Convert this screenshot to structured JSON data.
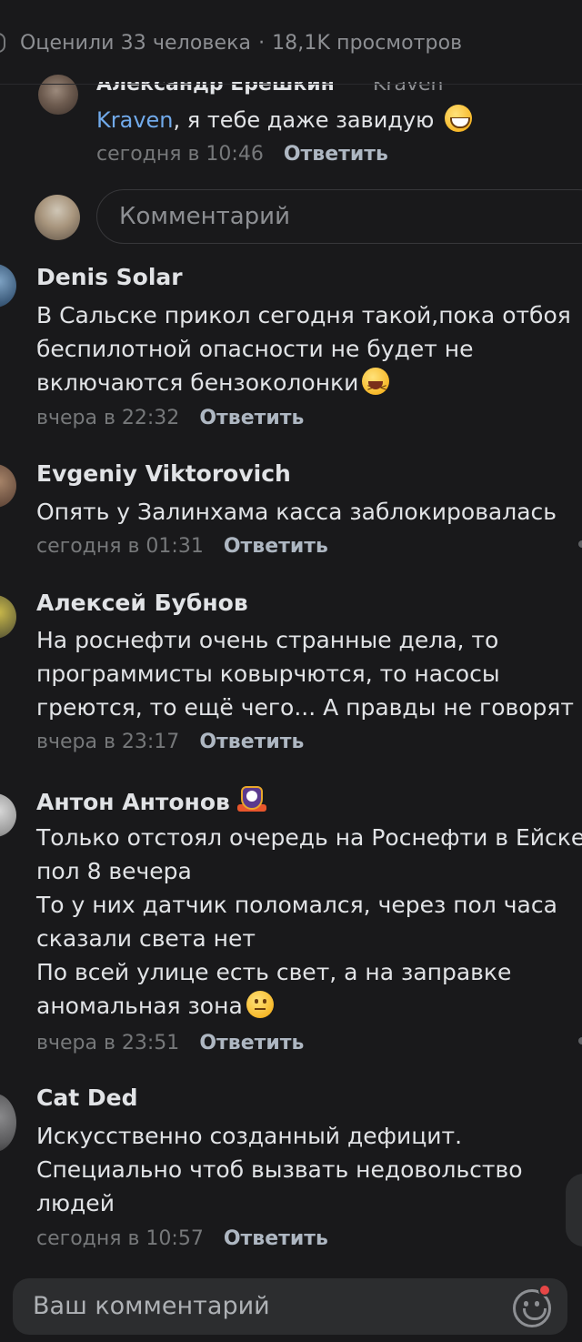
{
  "stats": {
    "rated": "Оценили 33 человека",
    "separator": "·",
    "views": "18,1K просмотров"
  },
  "top_reply": {
    "author": "Александр Ерёшкин",
    "reply_to": "Kraven",
    "mention": "Kraven",
    "text": ", я тебе даже завидую",
    "emoji": "grinning-face",
    "time": "сегодня в 10:46",
    "reply_label": "Ответить"
  },
  "reply_input": {
    "placeholder": "Комментарий"
  },
  "comments": [
    {
      "author": "Denis Solar",
      "lines": [
        "В Сальске прикол сегодня такой,пока отбоя",
        "беспилотной опасности не будет не",
        "включаются бензоколонки"
      ],
      "emoji": "laughing-face",
      "time": "вчера в 22:32",
      "reply_label": "Ответить",
      "avatar_color": "#3b5a7a"
    },
    {
      "author": "Evgeniy Viktorovich",
      "lines": [
        "Опять у Залинхама касса заблокировалась"
      ],
      "time": "сегодня в 01:31",
      "reply_label": "Ответить",
      "avatar_color": "#6b5040"
    },
    {
      "author": "Алексей Бубнов",
      "lines": [
        "На роснефти очень странные дела, то",
        "программисты ковырчются, то насосы",
        "греются, то ещё чего... А правды не говорят"
      ],
      "time": "вчера в 23:17",
      "reply_label": "Ответить",
      "avatar_color": "#6f6a3a"
    },
    {
      "author": "Антон Антонов",
      "badge": "donut-badge-icon",
      "lines": [
        "Только отстоял очередь на Роснефти в Ейске",
        "пол 8 вечера",
        "То у них датчик поломался, через пол часа",
        "сказали света нет",
        "По всей улице есть свет, а на заправке",
        "аномальная зона"
      ],
      "emoji": "neutral-face",
      "time": "вчера в 23:51",
      "reply_label": "Ответить",
      "avatar_color": "#9a9a9a"
    },
    {
      "author": "Cat Ded",
      "lines": [
        "Искусственно созданный дефицит.",
        "Специально чтоб вызвать недовольство",
        "людей"
      ],
      "time": "сегодня в 10:57",
      "reply_label": "Ответить",
      "avatar_color": "#5a5a5c"
    }
  ],
  "bottom_input": {
    "placeholder": "Ваш комментарий"
  }
}
